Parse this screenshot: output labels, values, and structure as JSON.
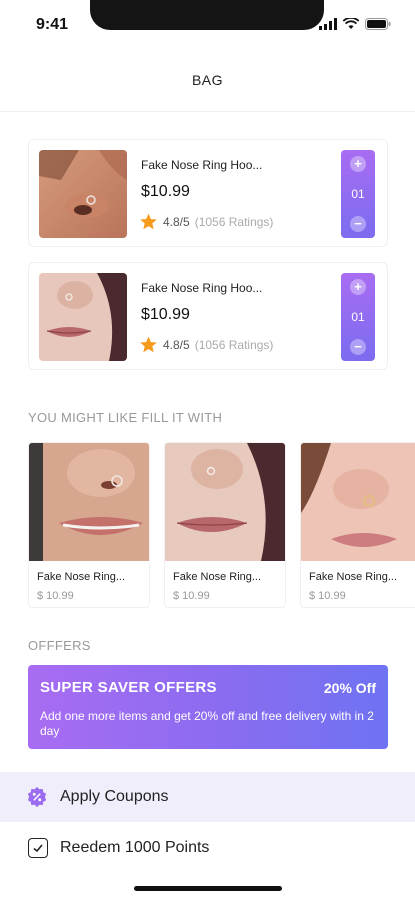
{
  "status_bar": {
    "time": "9:41"
  },
  "header": {
    "title": "BAG"
  },
  "cart": {
    "items": [
      {
        "title": "Fake Nose Ring Hoo...",
        "price": "$10.99",
        "rating": "4.8/5",
        "ratings_count": "(1056 Ratings)",
        "quantity": "01"
      },
      {
        "title": "Fake Nose Ring Hoo...",
        "price": "$10.99",
        "rating": "4.8/5",
        "ratings_count": "(1056 Ratings)",
        "quantity": "01"
      }
    ]
  },
  "suggestions": {
    "heading": "YOU MIGHT LIKE FILL IT WITH",
    "items": [
      {
        "name": "Fake Nose Ring...",
        "price": "$ 10.99"
      },
      {
        "name": "Fake Nose Ring...",
        "price": "$ 10.99"
      },
      {
        "name": "Fake Nose Ring...",
        "price": "$ 10.99"
      }
    ]
  },
  "offers": {
    "heading": "OFFFERS",
    "banner": {
      "title": "SUPER SAVER OFFERS",
      "percent": "20% Off",
      "description": "Add one more items and get 20% off and free delivery with in 2 day"
    }
  },
  "actions": {
    "apply_coupons": "Apply Coupons",
    "redeem_points": "Reedem 1000 Points"
  },
  "colors": {
    "accent": "#9b6cf2",
    "star": "#f59a1b"
  }
}
